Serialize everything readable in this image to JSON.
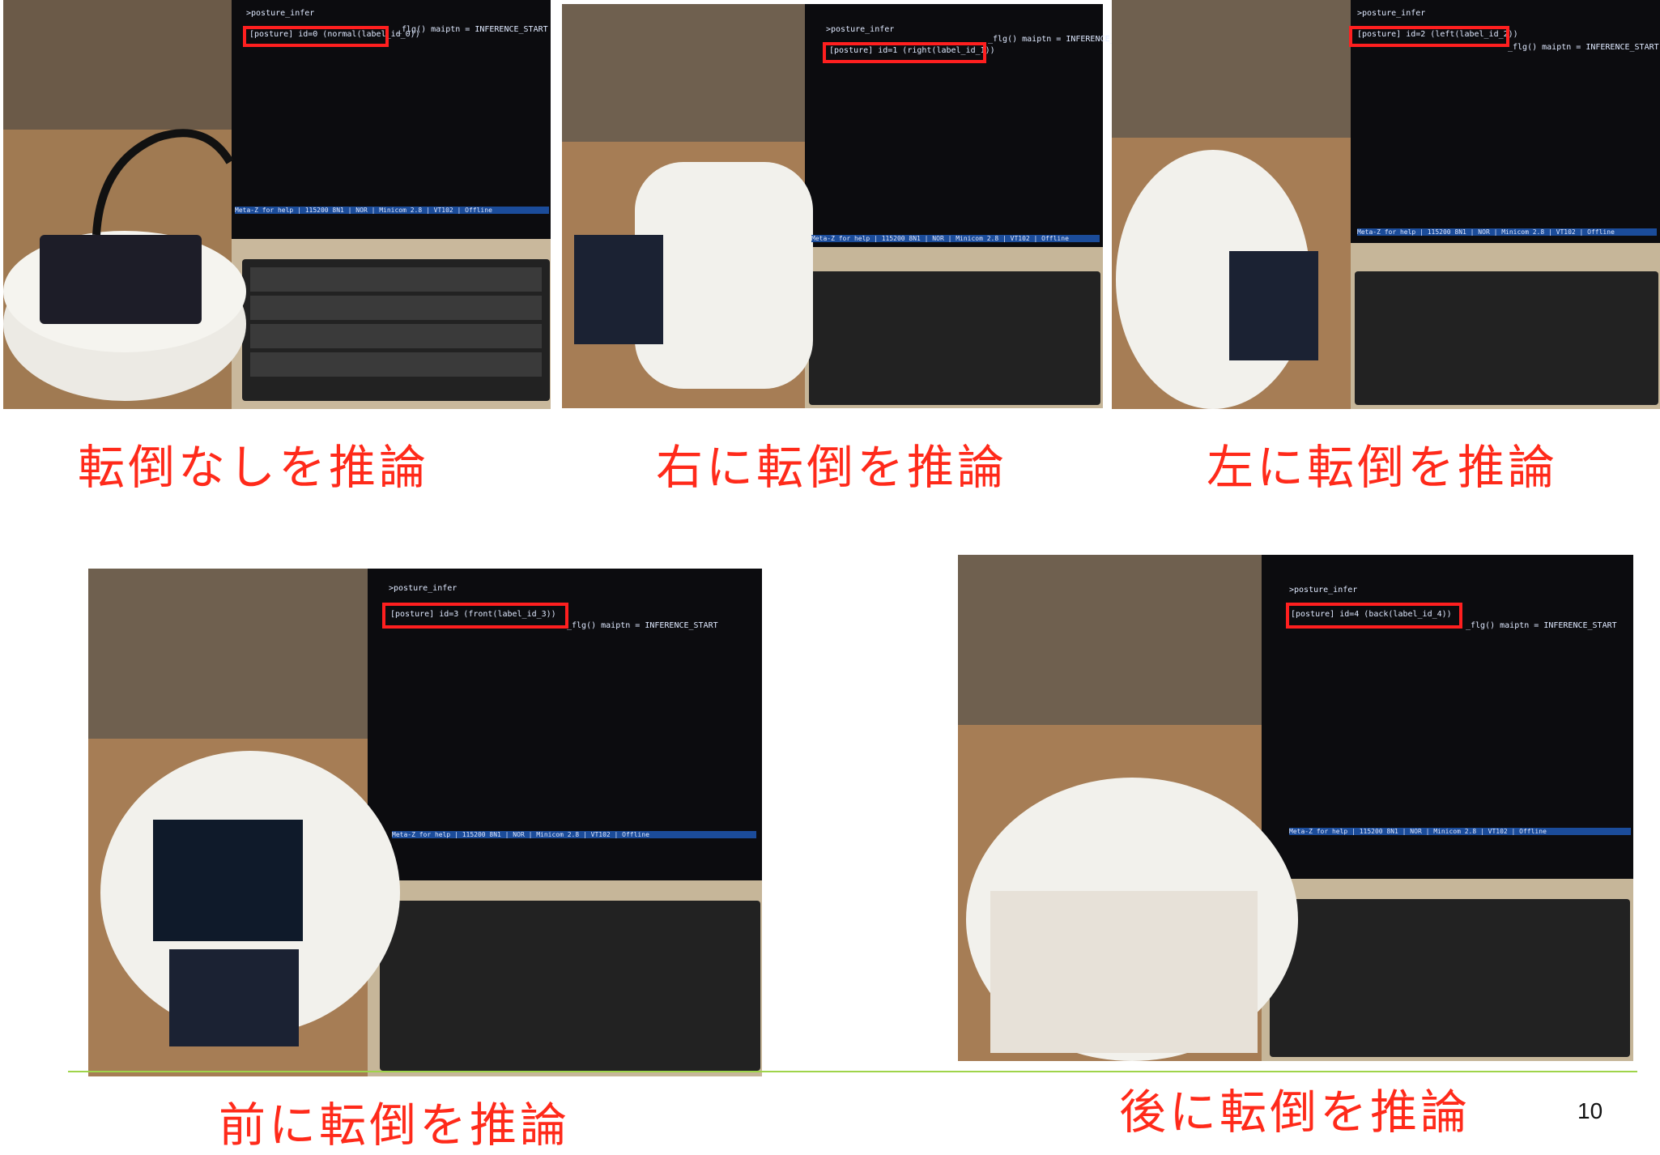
{
  "captions": [
    "転倒なしを推論",
    "右に転倒を推論",
    "左に転倒を推論",
    "前に転倒を推論",
    "後に転倒を推論"
  ],
  "terminal": {
    "prompt": ">posture_infer",
    "results": [
      "[posture] id=0 (normal(label_id_0))",
      "[posture] id=1 (right(label_id_1))",
      "[posture] id=2 (left(label_id_2))",
      "[posture] id=3 (front(label_id_3))",
      "[posture] id=4 (back(label_id_4))"
    ],
    "log1": "_flg() maiptn = INFERENCE_START",
    "status": "Meta-Z for help | 115200 8N1 | NOR | Minicom 2.8 | VT102 | Offline"
  },
  "page_number": "10",
  "colors": {
    "caption": "#ff2a1a",
    "highlight": "#ff1f1f",
    "rule": "#9fd44a"
  }
}
